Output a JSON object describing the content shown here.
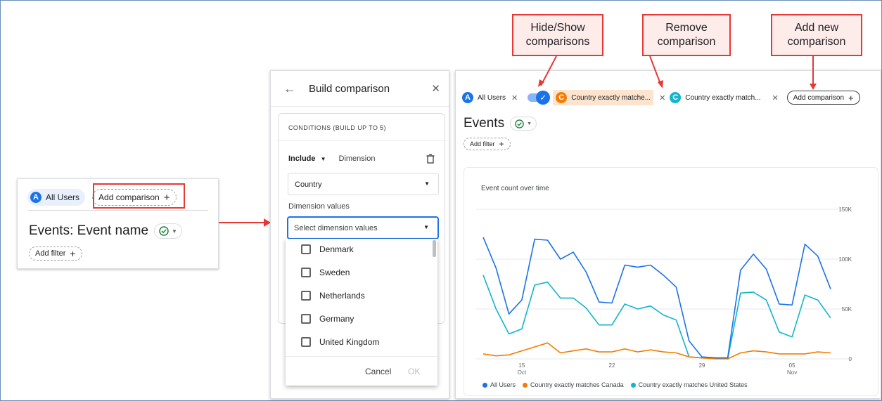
{
  "panel1": {
    "chip_badge": "A",
    "chip_label": "All Users",
    "add_comparison": "Add comparison",
    "plus": "+",
    "title": "Events: Event name",
    "add_filter": "Add filter"
  },
  "panel2": {
    "back": "←",
    "title": "Build comparison",
    "close": "✕",
    "conditions_header": "CONDITIONS (BUILD UP TO 5)",
    "include": "Include",
    "dimension_label": "Dimension",
    "dimension_value": "Country",
    "dimension_values_label": "Dimension values",
    "select_placeholder": "Select dimension values",
    "options": [
      "Denmark",
      "Sweden",
      "Netherlands",
      "Germany",
      "United Kingdom"
    ],
    "cancel": "Cancel",
    "ok": "OK"
  },
  "callouts": {
    "hide_show": "Hide/Show comparisons",
    "remove": "Remove comparison",
    "add_new": "Add new comparison"
  },
  "panel3": {
    "chip_all_users": "All Users",
    "chip_canada": "Country exactly matche...",
    "chip_us": "Country exactly match...",
    "badge_a": "A",
    "badge_c": "C",
    "add_comparison": "Add comparison",
    "events_title": "Events",
    "add_filter": "Add filter",
    "close_x": "✕"
  },
  "colors": {
    "all_users": "#1a73e8",
    "canada": "#f57c00",
    "us": "#12b5cb",
    "callout_border": "#e53935",
    "callout_fill": "#fdecea"
  },
  "chart_data": {
    "type": "line",
    "title": "Event count over time",
    "x_ticks": [
      {
        "label": "15",
        "sub": "Oct",
        "index": 3
      },
      {
        "label": "22",
        "sub": "",
        "index": 10
      },
      {
        "label": "29",
        "sub": "",
        "index": 17
      },
      {
        "label": "05",
        "sub": "Nov",
        "index": 24
      }
    ],
    "y_ticks": [
      "0",
      "50K",
      "100K",
      "150K"
    ],
    "ylim": [
      0,
      150000
    ],
    "series": [
      {
        "name": "All Users",
        "color": "#1a73e8",
        "values": [
          122000,
          91000,
          45000,
          59000,
          120000,
          119000,
          100000,
          107000,
          87000,
          57000,
          56000,
          94000,
          92000,
          94000,
          84000,
          72000,
          18000,
          2000,
          1000,
          1000,
          89000,
          105000,
          90000,
          55000,
          54000,
          115000,
          103000,
          70000
        ]
      },
      {
        "name": "Country exactly matches Canada",
        "color": "#f57c00",
        "values": [
          5000,
          3000,
          4000,
          8000,
          12000,
          16000,
          6000,
          8000,
          10000,
          7000,
          7000,
          10000,
          7000,
          9000,
          7000,
          6000,
          2000,
          1000,
          0,
          0,
          6000,
          8000,
          7000,
          5000,
          5000,
          5000,
          7000,
          6000
        ]
      },
      {
        "name": "Country exactly matches United States",
        "color": "#12b5cb",
        "values": [
          84000,
          50000,
          25000,
          30000,
          74000,
          77000,
          61000,
          61000,
          51000,
          34000,
          34000,
          55000,
          50000,
          53000,
          44000,
          39000,
          2000,
          1000,
          1000,
          0,
          66000,
          67000,
          59000,
          27000,
          22000,
          64000,
          59000,
          41000
        ]
      }
    ]
  }
}
